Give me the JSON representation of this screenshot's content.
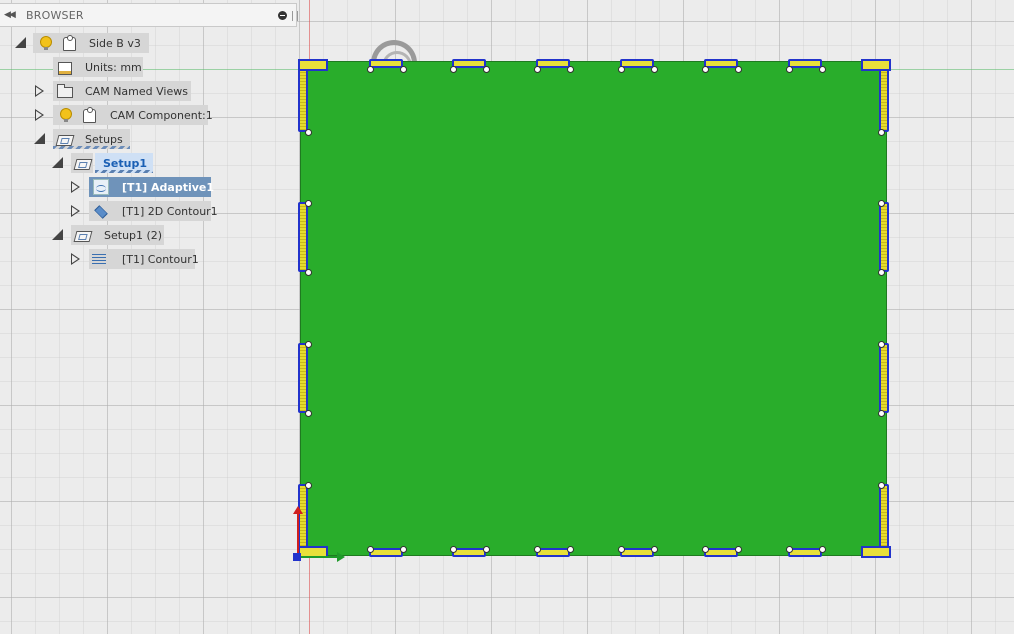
{
  "browser": {
    "title": "BROWSER",
    "tree": [
      {
        "label": "Side B v3",
        "icon": "document-icon",
        "expand": "expanded",
        "state": "normal"
      },
      {
        "label": "Units: mm",
        "icon": "units-icon",
        "expand": "none",
        "state": "normal"
      },
      {
        "label": "CAM Named Views",
        "icon": "folder-icon",
        "expand": "collapsed",
        "state": "normal"
      },
      {
        "label": "CAM Component:1",
        "icon": "component-icon",
        "expand": "collapsed",
        "state": "normal"
      },
      {
        "label": "Setups",
        "icon": "setups-folder-icon",
        "expand": "expanded",
        "state": "normal"
      },
      {
        "label": "Setup1",
        "icon": "setup-icon",
        "expand": "expanded",
        "state": "active"
      },
      {
        "label": "[T1] Adaptive1",
        "icon": "adaptive-clearing-icon",
        "expand": "collapsed",
        "state": "selected"
      },
      {
        "label": "[T1] 2D Contour1",
        "icon": "2d-contour-icon",
        "expand": "collapsed",
        "state": "normal"
      },
      {
        "label": "Setup1 (2)",
        "icon": "setup-icon",
        "expand": "expanded",
        "state": "normal"
      },
      {
        "label": "[T1] Contour1",
        "icon": "contour-icon",
        "expand": "collapsed",
        "state": "normal"
      }
    ]
  },
  "viewport": {
    "part_color": "#29ad2b",
    "toolpath_color": "#e8e03a",
    "path_outline_color": "#2233cc",
    "axis_colors": {
      "x": "#1f9a2a",
      "z": "#d02020"
    }
  }
}
